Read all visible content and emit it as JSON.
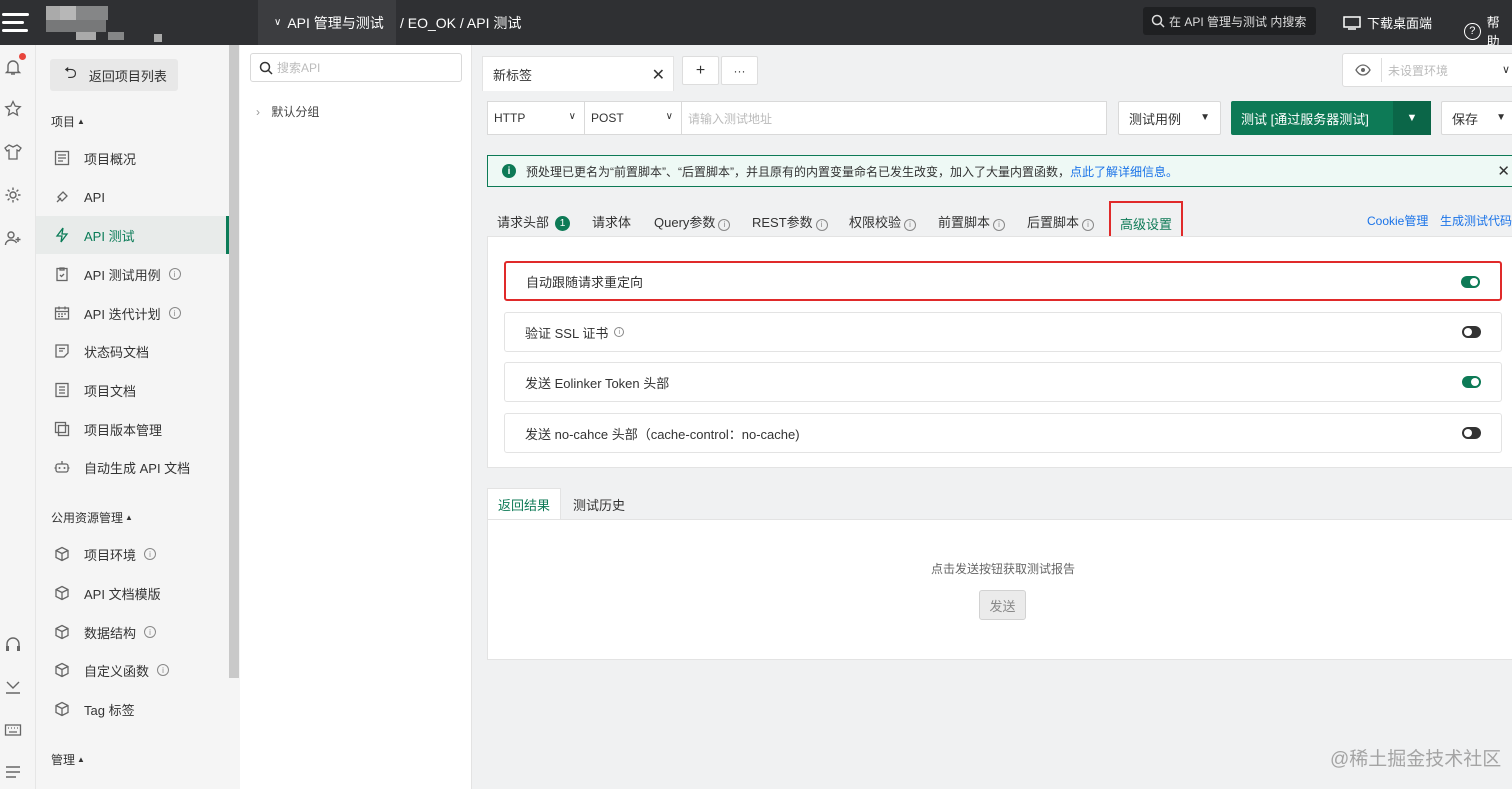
{
  "topbar": {
    "project_switch": "API 管理与测试",
    "breadcrumb": "/ EO_OK / API 测试",
    "search_placeholder": "在 API 管理与测试 内搜索",
    "download_label": "下载桌面端",
    "help_label": "帮助"
  },
  "nav": {
    "back_label": "返回项目列表",
    "section_project": "项目",
    "section_public": "公用资源管理",
    "section_manage": "管理",
    "project_items": [
      {
        "label": "项目概况",
        "icon": "overview-icon"
      },
      {
        "label": "API",
        "icon": "api-icon"
      },
      {
        "label": "API 测试",
        "icon": "bolt-icon",
        "active": true
      },
      {
        "label": "API 测试用例",
        "icon": "clipboard-icon",
        "info": true
      },
      {
        "label": "API 迭代计划",
        "icon": "calendar-icon",
        "info": true
      },
      {
        "label": "状态码文档",
        "icon": "doc-edit-icon"
      },
      {
        "label": "项目文档",
        "icon": "doc-list-icon"
      },
      {
        "label": "项目版本管理",
        "icon": "versions-icon"
      },
      {
        "label": "自动生成 API 文档",
        "icon": "robot-icon"
      }
    ],
    "public_items": [
      {
        "label": "项目环境",
        "icon": "cube-icon",
        "info": true
      },
      {
        "label": "API 文档模版",
        "icon": "cube-icon"
      },
      {
        "label": "数据结构",
        "icon": "cube-icon",
        "info": true
      },
      {
        "label": "自定义函数",
        "icon": "cube-icon",
        "info": true
      },
      {
        "label": "Tag 标签",
        "icon": "cube-icon"
      }
    ]
  },
  "tree": {
    "search_placeholder": "搜索API",
    "default_group": "默认分组"
  },
  "main": {
    "tab_label": "新标签",
    "add_tab": "+",
    "more_tab": "···",
    "env_placeholder": "未设置环境",
    "protocol": "HTTP",
    "method": "POST",
    "url_placeholder": "请输入测试地址",
    "case_label": "测试用例",
    "test_label": "测试 [通过服务器测试]",
    "save_label": "保存",
    "notice_text": "预处理已更名为“前置脚本”、“后置脚本”，并且原有的内置变量命名已发生改变，加入了大量内置函数，",
    "notice_link": "点此了解详细信息。",
    "subtabs": {
      "headers": "请求头部",
      "headers_count": "1",
      "body": "请求体",
      "query": "Query参数",
      "rest": "REST参数",
      "auth": "权限校验",
      "pre": "前置脚本",
      "post": "后置脚本",
      "advanced": "高级设置",
      "cookie": "Cookie管理",
      "gen_code": "生成测试代码"
    },
    "settings": [
      {
        "label": "自动跟随请求重定向",
        "on": true
      },
      {
        "label": "验证 SSL 证书",
        "on": false,
        "info": true
      },
      {
        "label": "发送 Eolinker Token 头部",
        "on": true
      },
      {
        "label": "发送 no-cahce 头部（cache-control：no-cache)",
        "on": false
      }
    ],
    "result_tab": "返回结果",
    "history_tab": "测试历史",
    "result_tip": "点击发送按钮获取测试报告",
    "send_label": "发送"
  },
  "watermark": "@稀土掘金技术社区",
  "colors": {
    "accent": "#0d7a56",
    "link": "#1a73e8",
    "highlight_box": "#e02a2a",
    "topbar": "#2f3033"
  }
}
